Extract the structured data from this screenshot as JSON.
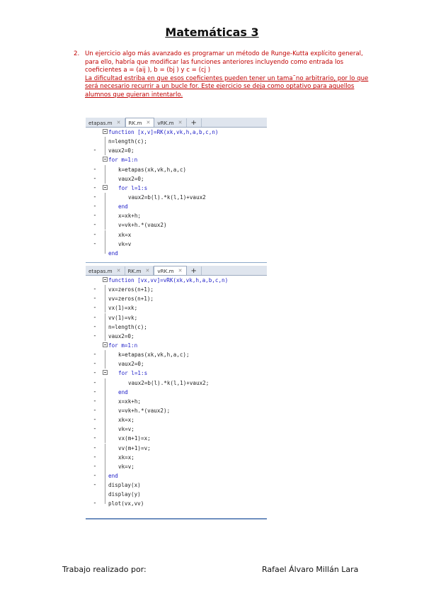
{
  "title": "Matemáticas 3",
  "item": {
    "number": "2.",
    "text1": "Un ejercicio algo más avanzado es programar un método de Runge-Kutta explícito general, para ello, habría que modificar las funciones anteriores incluyendo como entrada los coeficientes a = (aij ), b = (bj ) y c = (cj )",
    "text2": "La dificultad estriba en que esos coeficientes pueden tener un tama˜no arbitrario, por lo que será necesario recurrir a un bucle for. Este ejercicio se deja como optativo para aquellos alumnos que quieran intentarlo."
  },
  "editor1": {
    "tabs": [
      "etapas.m",
      "RK.m",
      "vRK.m"
    ],
    "active_tab": "RK.m",
    "plus": "+",
    "lines": [
      {
        "gutter": "",
        "fold": true,
        "indent": 0,
        "text": "function [x,v]=RK(xk,vk,h,a,b,c,n)",
        "kw": true
      },
      {
        "gutter": "",
        "fold": false,
        "indent": 0,
        "text": "n=length(c);"
      },
      {
        "gutter": "-",
        "fold": false,
        "indent": 0,
        "text": "vaux2=0;"
      },
      {
        "gutter": "",
        "fold": true,
        "indent": 0,
        "text": "for m=1:n",
        "kw": true
      },
      {
        "gutter": "-",
        "fold": false,
        "indent": 1,
        "text": "k=etapas(xk,vk,h,a,c)"
      },
      {
        "gutter": "-",
        "fold": false,
        "indent": 1,
        "text": "vaux2=0;"
      },
      {
        "gutter": "-",
        "fold": true,
        "indent": 1,
        "text": "for l=1:s",
        "kw": true
      },
      {
        "gutter": "-",
        "fold": false,
        "indent": 2,
        "text": "vaux2=b(l).*k(l,1)+vaux2"
      },
      {
        "gutter": "-",
        "fold": false,
        "indent": 1,
        "text": "end",
        "kw": true
      },
      {
        "gutter": "-",
        "fold": false,
        "indent": 1,
        "text": "x=xk+h;"
      },
      {
        "gutter": "-",
        "fold": false,
        "indent": 1,
        "text": "v=vk+h.*(vaux2)"
      },
      {
        "gutter": "-",
        "fold": false,
        "indent": 1,
        "text": "xk=x"
      },
      {
        "gutter": "-",
        "fold": false,
        "indent": 1,
        "text": "vk=v"
      },
      {
        "gutter": "",
        "fold": false,
        "indent": 0,
        "text": "end",
        "kw": true
      }
    ]
  },
  "editor2": {
    "tabs": [
      "etapas.m",
      "RK.m",
      "vRK.m"
    ],
    "active_tab": "vRK.m",
    "plus": "+",
    "lines": [
      {
        "gutter": "",
        "fold": true,
        "indent": 0,
        "text": "function [vx,vv]=vRK(xk,vk,h,a,b,c,n)",
        "kw": true
      },
      {
        "gutter": "-",
        "fold": false,
        "indent": 0,
        "text": "vx=zeros(n+1);"
      },
      {
        "gutter": "-",
        "fold": false,
        "indent": 0,
        "text": "vv=zeros(n+1);"
      },
      {
        "gutter": "-",
        "fold": false,
        "indent": 0,
        "text": "vx(1)=xk;"
      },
      {
        "gutter": "-",
        "fold": false,
        "indent": 0,
        "text": "vv(1)=vk;"
      },
      {
        "gutter": "-",
        "fold": false,
        "indent": 0,
        "text": "n=length(c);"
      },
      {
        "gutter": "-",
        "fold": false,
        "indent": 0,
        "text": "vaux2=0;"
      },
      {
        "gutter": "",
        "fold": true,
        "indent": 0,
        "text": "for m=1:n",
        "kw": true
      },
      {
        "gutter": "-",
        "fold": false,
        "indent": 1,
        "text": "k=etapas(xk,vk,h,a,c);"
      },
      {
        "gutter": "-",
        "fold": false,
        "indent": 1,
        "text": "vaux2=0;"
      },
      {
        "gutter": "-",
        "fold": true,
        "indent": 1,
        "text": "for l=1:s",
        "kw": true
      },
      {
        "gutter": "-",
        "fold": false,
        "indent": 2,
        "text": "vaux2=b(l).*k(l,1)+vaux2;"
      },
      {
        "gutter": "-",
        "fold": false,
        "indent": 1,
        "text": "end",
        "kw": true
      },
      {
        "gutter": "-",
        "fold": false,
        "indent": 1,
        "text": "x=xk+h;"
      },
      {
        "gutter": "-",
        "fold": false,
        "indent": 1,
        "text": "v=vk+h.*(vaux2);"
      },
      {
        "gutter": "-",
        "fold": false,
        "indent": 1,
        "text": "xk=x;"
      },
      {
        "gutter": "-",
        "fold": false,
        "indent": 1,
        "text": "vk=v;"
      },
      {
        "gutter": "-",
        "fold": false,
        "indent": 1,
        "text": "vx(m+1)=x;"
      },
      {
        "gutter": "-",
        "fold": false,
        "indent": 1,
        "text": "vv(m+1)=v;"
      },
      {
        "gutter": "-",
        "fold": false,
        "indent": 1,
        "text": "xk=x;"
      },
      {
        "gutter": "-",
        "fold": false,
        "indent": 1,
        "text": "vk=v;"
      },
      {
        "gutter": "-",
        "fold": false,
        "indent": 0,
        "text": "end",
        "kw": true
      },
      {
        "gutter": "-",
        "fold": false,
        "indent": 0,
        "text": "display(x)"
      },
      {
        "gutter": "",
        "fold": false,
        "indent": 0,
        "text": "display(y)"
      },
      {
        "gutter": "-",
        "fold": false,
        "indent": 0,
        "text": "plot(vx,vv)"
      }
    ]
  },
  "footer": {
    "left": "Trabajo realizado por:",
    "right": "Rafael Álvaro Millán Lara"
  }
}
